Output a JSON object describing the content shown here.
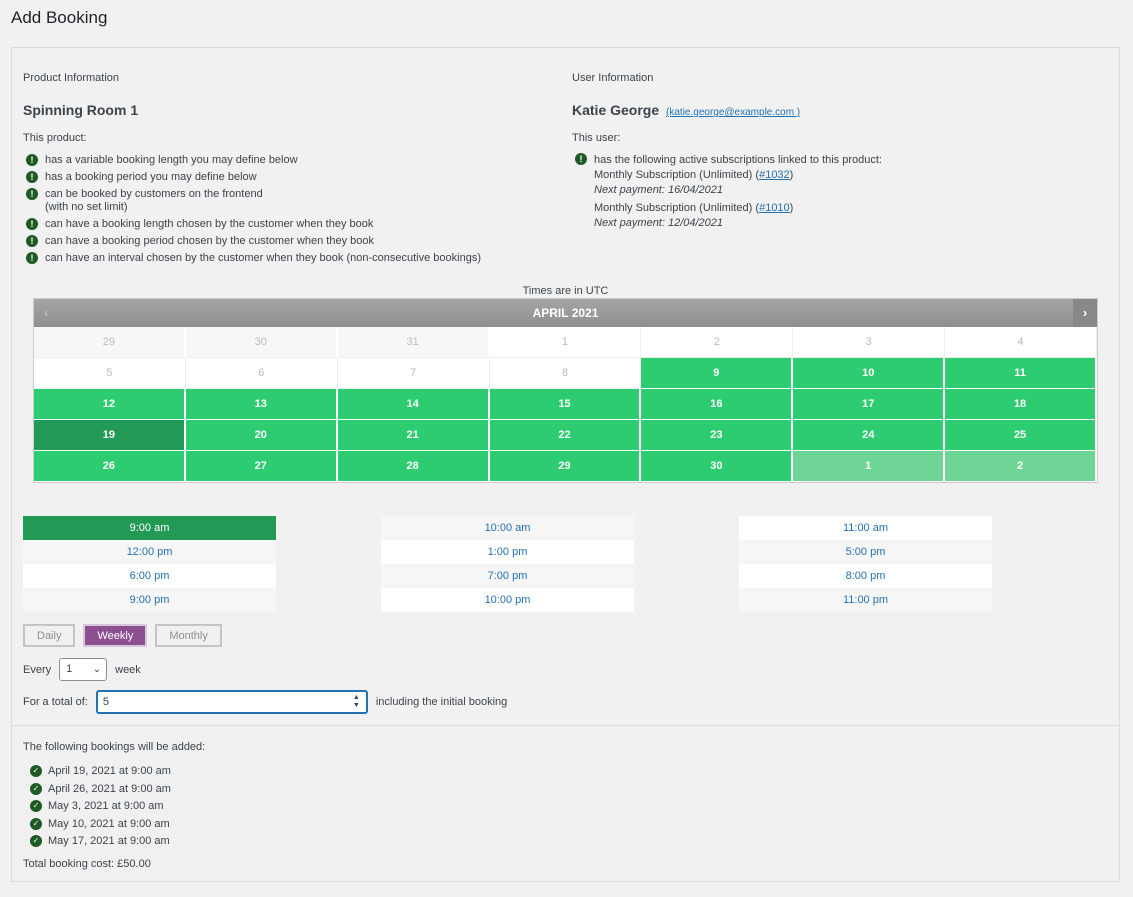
{
  "page": {
    "title": "Add Booking"
  },
  "product": {
    "section_title": "Product Information",
    "name": "Spinning Room 1",
    "intro": "This product:",
    "features": [
      {
        "text": "has a variable booking length you may define below",
        "sub": ""
      },
      {
        "text": "has a booking period you may define below",
        "sub": ""
      },
      {
        "text": "can be booked by customers on the frontend",
        "sub": "(with no set limit)"
      },
      {
        "text": "can have a booking length chosen by the customer when they book",
        "sub": ""
      },
      {
        "text": "can have a booking period chosen by the customer when they book",
        "sub": ""
      },
      {
        "text": "can have an interval chosen by the customer when they book (non-consecutive bookings)",
        "sub": ""
      }
    ]
  },
  "user": {
    "section_title": "User Information",
    "name": "Katie George",
    "email": "(katie.george@example.com )",
    "intro": "This user:",
    "subs_heading": "has the following active subscriptions linked to this product:",
    "subscriptions": [
      {
        "name": "Monthly Subscription (Unlimited)",
        "id": "#1032",
        "next": "Next payment: 16/04/2021"
      },
      {
        "name": "Monthly Subscription (Unlimited)",
        "id": "#1010",
        "next": "Next payment: 12/04/2021"
      }
    ]
  },
  "calendar": {
    "timezone_note": "Times are in UTC",
    "month_label": "APRIL 2021",
    "prev_icon": "‹",
    "next_icon": "›",
    "weeks": [
      [
        {
          "d": "29",
          "s": "other"
        },
        {
          "d": "30",
          "s": "other"
        },
        {
          "d": "31",
          "s": "other"
        },
        {
          "d": "1",
          "s": "unavail"
        },
        {
          "d": "2",
          "s": "unavail"
        },
        {
          "d": "3",
          "s": "unavail"
        },
        {
          "d": "4",
          "s": "unavail"
        }
      ],
      [
        {
          "d": "5",
          "s": "unavail"
        },
        {
          "d": "6",
          "s": "unavail"
        },
        {
          "d": "7",
          "s": "unavail"
        },
        {
          "d": "8",
          "s": "unavail"
        },
        {
          "d": "9",
          "s": "avail"
        },
        {
          "d": "10",
          "s": "avail"
        },
        {
          "d": "11",
          "s": "avail"
        }
      ],
      [
        {
          "d": "12",
          "s": "avail"
        },
        {
          "d": "13",
          "s": "avail"
        },
        {
          "d": "14",
          "s": "avail"
        },
        {
          "d": "15",
          "s": "avail"
        },
        {
          "d": "16",
          "s": "avail"
        },
        {
          "d": "17",
          "s": "avail"
        },
        {
          "d": "18",
          "s": "avail"
        }
      ],
      [
        {
          "d": "19",
          "s": "selected"
        },
        {
          "d": "20",
          "s": "avail"
        },
        {
          "d": "21",
          "s": "avail"
        },
        {
          "d": "22",
          "s": "avail"
        },
        {
          "d": "23",
          "s": "avail"
        },
        {
          "d": "24",
          "s": "avail"
        },
        {
          "d": "25",
          "s": "avail"
        }
      ],
      [
        {
          "d": "26",
          "s": "avail"
        },
        {
          "d": "27",
          "s": "avail"
        },
        {
          "d": "28",
          "s": "avail"
        },
        {
          "d": "29",
          "s": "avail"
        },
        {
          "d": "30",
          "s": "avail"
        },
        {
          "d": "1",
          "s": "next-avail"
        },
        {
          "d": "2",
          "s": "next-avail"
        }
      ]
    ]
  },
  "time_slots": [
    [
      {
        "t": "9:00 am",
        "s": "sel"
      },
      {
        "t": "12:00 pm",
        "s": "alt"
      },
      {
        "t": "6:00 pm",
        "s": "plain"
      },
      {
        "t": "9:00 pm",
        "s": "alt"
      }
    ],
    [
      {
        "t": "10:00 am",
        "s": "alt"
      },
      {
        "t": "1:00 pm",
        "s": "plain"
      },
      {
        "t": "7:00 pm",
        "s": "alt"
      },
      {
        "t": "10:00 pm",
        "s": "plain"
      }
    ],
    [
      {
        "t": "11:00 am",
        "s": "plain"
      },
      {
        "t": "5:00 pm",
        "s": "alt"
      },
      {
        "t": "8:00 pm",
        "s": "plain"
      },
      {
        "t": "11:00 pm",
        "s": "alt"
      }
    ]
  ],
  "frequency": {
    "daily": "Daily",
    "weekly": "Weekly",
    "monthly": "Monthly",
    "active": "weekly"
  },
  "every": {
    "label": "Every",
    "value": "1",
    "unit": "week"
  },
  "total": {
    "label": "For a total of:",
    "value": "5",
    "suffix": "including the initial booking"
  },
  "summary": {
    "title": "The following bookings will be added:",
    "bookings": [
      "April 19, 2021 at 9:00 am",
      "April 26, 2021 at 9:00 am",
      "May 3, 2021 at 9:00 am",
      "May 10, 2021 at 9:00 am",
      "May 17, 2021 at 9:00 am"
    ],
    "cost": "Total booking cost: £50.00"
  },
  "colors": {
    "available": "#2ecc71",
    "selected": "#229954",
    "weekly_active": "#8c4f90",
    "link": "#2271b1"
  }
}
